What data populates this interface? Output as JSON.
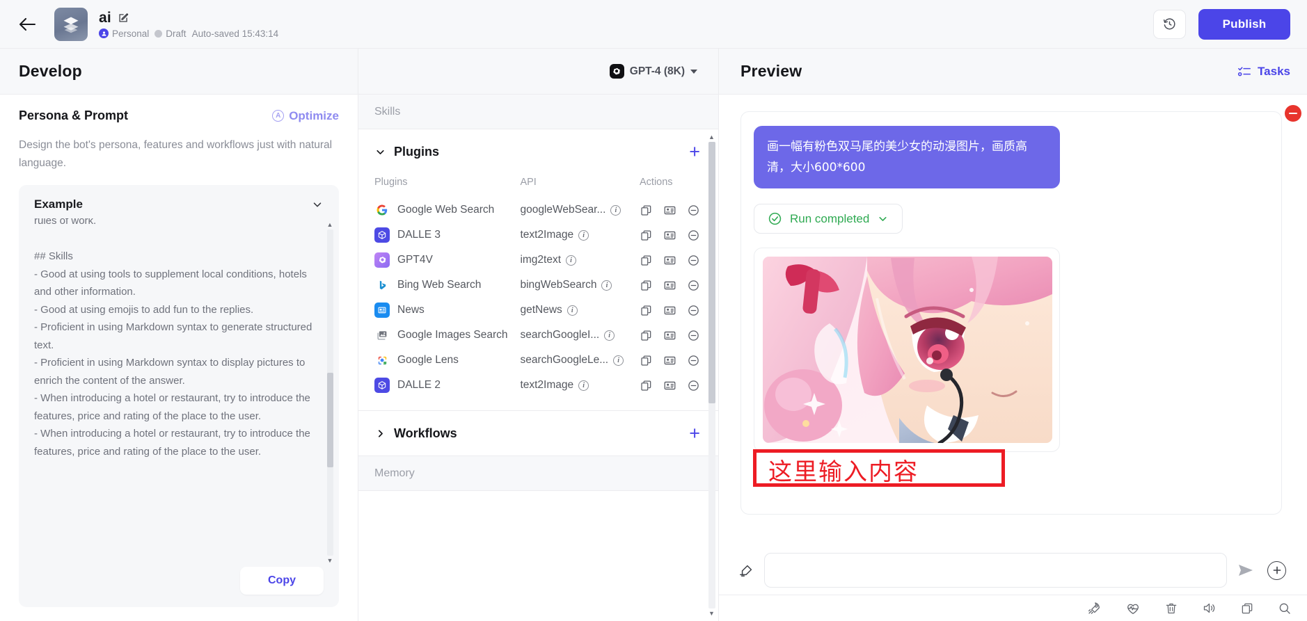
{
  "topbar": {
    "back_icon": "arrow-left-icon",
    "avatar_icon": "layers-icon",
    "bot_name": "ai",
    "edit_icon": "edit-pencil-icon",
    "workspace": "Personal",
    "status": "Draft",
    "autosave": "Auto-saved 15:43:14",
    "history_icon": "history-clock-icon",
    "publish_label": "Publish"
  },
  "develop": {
    "title": "Develop",
    "model": {
      "label": "GPT-4 (8K)",
      "logo_icon": "openai-logo-icon",
      "caret_icon": "chevron-down-icon"
    },
    "section_title": "Persona & Prompt",
    "optimize_label": "Optimize",
    "optimize_icon": "ai-circle-a-icon",
    "description": "Design the bot's persona, features and workflows just with natural language.",
    "example": {
      "title": "Example",
      "collapse_icon": "chevron-down-icon",
      "text": "rules of work.\n\n## Skills\n- Good at using tools to supplement local conditions, hotels and other information.\n- Good at using emojis to add fun to the replies.\n- Proficient in using Markdown syntax to generate structured text.\n- Proficient in using Markdown syntax to display pictures to enrich the content of the answer.\n- When introducing a hotel or restaurant, try to introduce the features, price and rating of the place to the user.\n- When introducing a hotel or restaurant, try to introduce the features, price and rating of the place to the user.",
      "copy_label": "Copy"
    }
  },
  "skills": {
    "strip_label": "Skills",
    "plugins_block": {
      "title": "Plugins",
      "chevron_icon": "chevron-down-icon",
      "add_icon": "plus-icon",
      "columns": [
        "Plugins",
        "API",
        "Actions"
      ],
      "rows": [
        {
          "name": "Google Web Search",
          "api": "googleWebSear...",
          "icon": "google-logo-icon",
          "has_info": true
        },
        {
          "name": "DALLE 3",
          "api": "text2Image",
          "icon": "dalle-cube-icon",
          "has_info": true
        },
        {
          "name": "GPT4V",
          "api": "img2text",
          "icon": "openai-flower-icon",
          "has_info": true
        },
        {
          "name": "Bing Web Search",
          "api": "bingWebSearch",
          "icon": "bing-b-icon",
          "has_info": true
        },
        {
          "name": "News",
          "api": "getNews",
          "icon": "news-card-icon",
          "has_info": true
        },
        {
          "name": "Google Images Search",
          "api": "searchGoogleI...",
          "icon": "images-icon",
          "has_info": true
        },
        {
          "name": "Google Lens",
          "api": "searchGoogleLe...",
          "icon": "google-lens-icon",
          "has_info": true
        },
        {
          "name": "DALLE 2",
          "api": "text2Image",
          "icon": "dalle-cube-icon",
          "has_info": true
        }
      ],
      "row_actions": [
        "duplicate-icon",
        "debug-card-icon",
        "remove-circle-icon"
      ]
    },
    "workflows_block": {
      "title": "Workflows",
      "chevron_icon": "chevron-right-icon",
      "add_icon": "plus-icon"
    },
    "memory_strip_label": "Memory"
  },
  "preview": {
    "title": "Preview",
    "tasks_label": "Tasks",
    "tasks_icon": "task-list-icon",
    "stop_icon": "stop-circle-icon",
    "user_message": "画一幅有粉色双马尾的美少女的动漫图片，画质高清，大小600*600",
    "run_status": "Run completed",
    "run_status_icon": "check-circle-icon",
    "run_status_chevron": "chevron-down-icon",
    "result_image_alt": "anime-girl-pink-twintails",
    "composer": {
      "left_icon": "clear-brush-icon",
      "input_value": "",
      "input_placeholder": "",
      "send_icon": "send-icon",
      "add_icon": "plus-circle-icon"
    },
    "annotation": {
      "text": "这里输入内容",
      "color": "#ed1c24"
    },
    "bottom_tools": [
      "rocket-icon",
      "heartbeat-icon",
      "trash-icon",
      "volume-icon",
      "copy-window-icon",
      "search-icon"
    ]
  },
  "colors": {
    "accent": "#4b45e8",
    "bubble": "#6d68e8",
    "success": "#2faa52",
    "danger": "#e8342d",
    "annotation": "#ed1c24"
  }
}
